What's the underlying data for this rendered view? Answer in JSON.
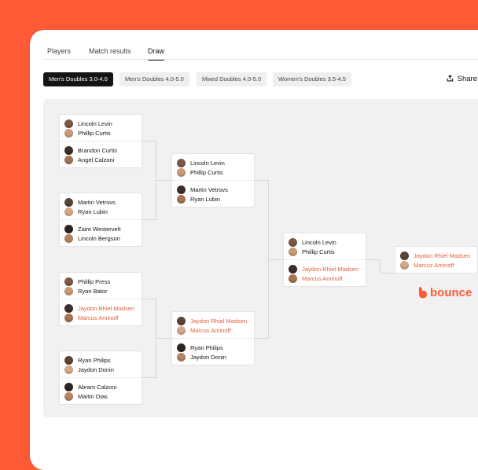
{
  "tabs": [
    {
      "label": "Players"
    },
    {
      "label": "Match results"
    },
    {
      "label": "Draw"
    }
  ],
  "categories": [
    {
      "label": "Men's Doubles 3.0-4.0"
    },
    {
      "label": "Men's Doubles 4.0-5.0"
    },
    {
      "label": "Mixed Doubles 4.0-5.0"
    },
    {
      "label": "Women's Doubles 3.5-4.5"
    }
  ],
  "share_label": "Share",
  "brand": {
    "name": "bounce",
    "color": "#ff5a36"
  },
  "accent": "#e5603e",
  "bracket": {
    "round1": [
      {
        "t1": [
          "Lincoln Levin",
          "Phillip Curtis"
        ],
        "t2": [
          "Brandon Curtis",
          "Angel Calzoni"
        ]
      },
      {
        "t1": [
          "Martin Vetrovs",
          "Ryan Lubin"
        ],
        "t2": [
          "Zaire Westervelt",
          "Lincoln Bergson"
        ]
      },
      {
        "t1": [
          "Phillip Press",
          "Ryan Bator"
        ],
        "t2": [
          "Jaydon Rhiel Madsen",
          "Marcus Aminoff"
        ]
      },
      {
        "t1": [
          "Ryan Philips",
          "Jaydon Donin"
        ],
        "t2": [
          "Abram Calzoni",
          "Martin Dias"
        ]
      }
    ],
    "round2": [
      {
        "t1": [
          "Lincoln Levin",
          "Phillip Curtis"
        ],
        "t2": [
          "Martin Vetrovs",
          "Ryan Lubin"
        ]
      },
      {
        "t1": [
          "Jaydon Rhiel Madsen",
          "Marcus Aminoff"
        ],
        "t2": [
          "Ryan Philips",
          "Jaydon Donin"
        ]
      }
    ],
    "semi": {
      "t1": [
        "Lincoln Levin",
        "Phillip Curtis"
      ],
      "t2": [
        "Jaydon Rhiel Madsen",
        "Marcus Aminoff"
      ]
    },
    "final": {
      "t1": [
        "Jaydon Rhiel Madsen",
        "Marcus Aminoff"
      ]
    }
  }
}
